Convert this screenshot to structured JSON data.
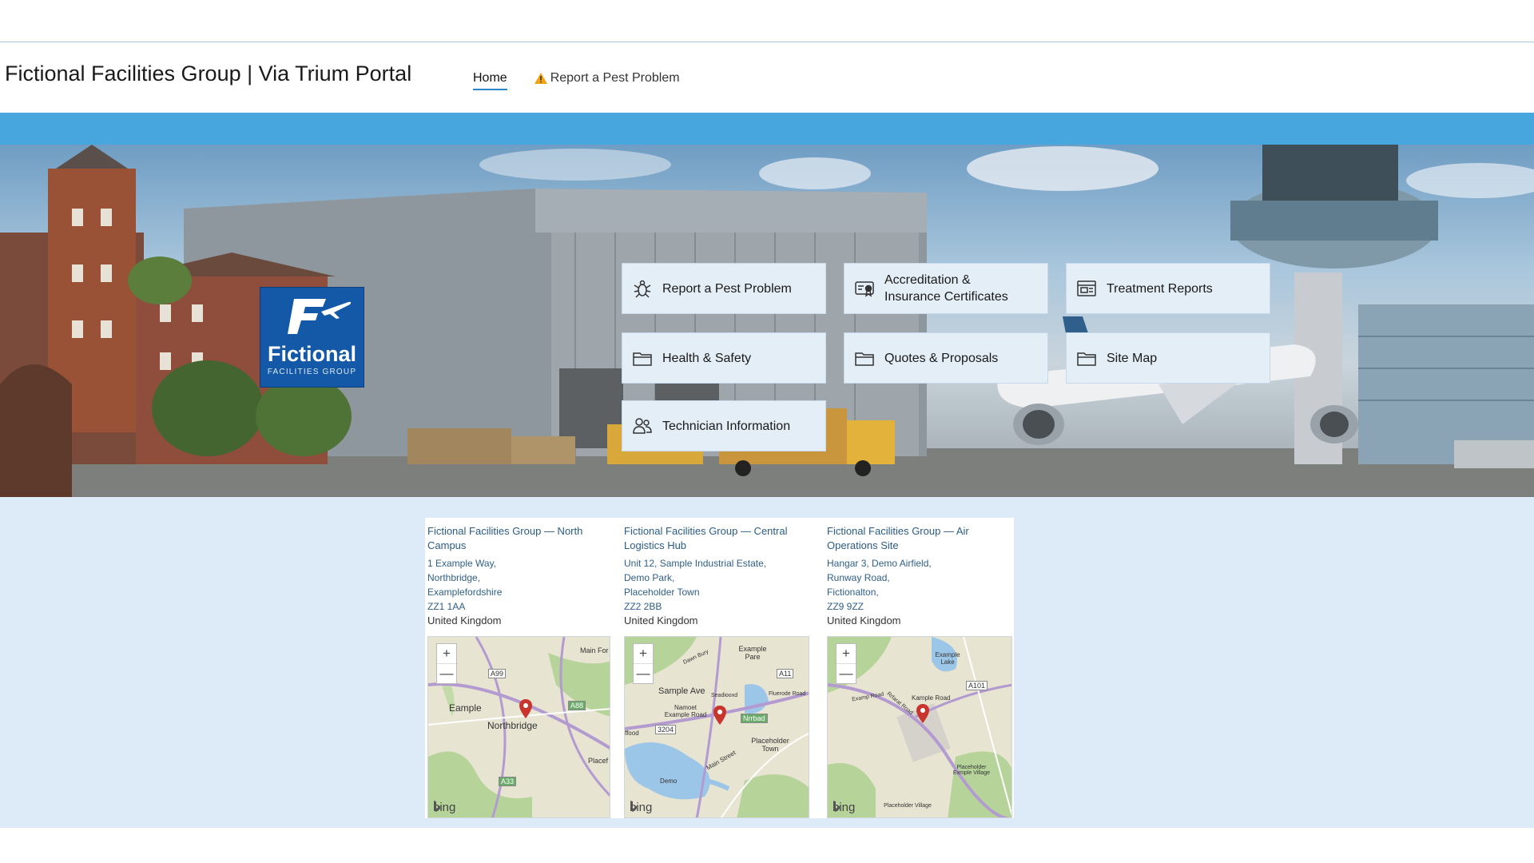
{
  "header": {
    "title": "Fictional Facilities Group  |  Via Trium Portal",
    "nav": [
      {
        "label": "Home",
        "active": true
      },
      {
        "label": "Report a Pest Problem",
        "icon": "warning-icon"
      }
    ]
  },
  "colors": {
    "accent": "#47a6dd",
    "tile": "#e4eef7",
    "panel_bg": "#dcebf7",
    "logo": "#1458a8",
    "link": "#2b5c86"
  },
  "logo": {
    "word": "Fictional",
    "sub": "FACILITIES GROUP",
    "icon": "plane-f-icon"
  },
  "tiles": [
    {
      "label": "Report a Pest Problem",
      "icon": "pest-icon"
    },
    {
      "label": "Accreditation & Insurance Certificates",
      "icon": "certificate-icon"
    },
    {
      "label": "Treatment Reports",
      "icon": "report-icon"
    },
    {
      "label": "Health & Safety",
      "icon": "folder-icon"
    },
    {
      "label": "Quotes & Proposals",
      "icon": "folder-icon"
    },
    {
      "label": "Site Map",
      "icon": "folder-icon"
    },
    {
      "label": "Technician Information",
      "icon": "people-icon"
    }
  ],
  "locations": [
    {
      "name": "Fictional Facilities Group — North Campus",
      "address": [
        "1 Example Way,",
        "Northbridge,",
        "Examplefordshire",
        "ZZ1 1AA"
      ],
      "country": "United Kingdom",
      "map": {
        "zoom_in": "+",
        "zoom_out": "—",
        "attribution": "bing",
        "labels": [
          "Eample",
          "Northbridge",
          "Main For",
          "Placef"
        ],
        "roads": [
          "A99",
          "A88",
          "A33"
        ]
      }
    },
    {
      "name": "Fictional Facilities Group — Central Logistics Hub",
      "address": [
        "Unit 12, Sample Industrial Estate,",
        "Demo Park,",
        "Placeholder Town",
        "ZZ2 2BB"
      ],
      "country": "United Kingdom",
      "map": {
        "zoom_in": "+",
        "zoom_out": "—",
        "attribution": "bing",
        "labels": [
          "Sample Ave",
          "Example Pare",
          "Namoet Example Road",
          "Placeholder Town",
          "Main Street",
          "Demo",
          "ffood",
          "Fluerode Road",
          "Dawn Bury",
          "Seadiooxd"
        ],
        "roads": [
          "A11",
          "3204",
          "Nrrbad"
        ]
      }
    },
    {
      "name": "Fictional Facilities Group — Air Operations Site",
      "address": [
        "Hangar 3, Demo Airfield,",
        "Runway Road,",
        "Fictionalton,",
        "ZZ9 9ZZ"
      ],
      "country": "United Kingdom",
      "map": {
        "zoom_in": "+",
        "zoom_out": "—",
        "attribution": "bing",
        "labels": [
          "Example Lake",
          "Kample Road",
          "Placeholder Exmple Village",
          "Placeholder Village",
          "Examp Road",
          "Rrfarat Road"
        ],
        "roads": [
          "A101"
        ]
      }
    }
  ]
}
